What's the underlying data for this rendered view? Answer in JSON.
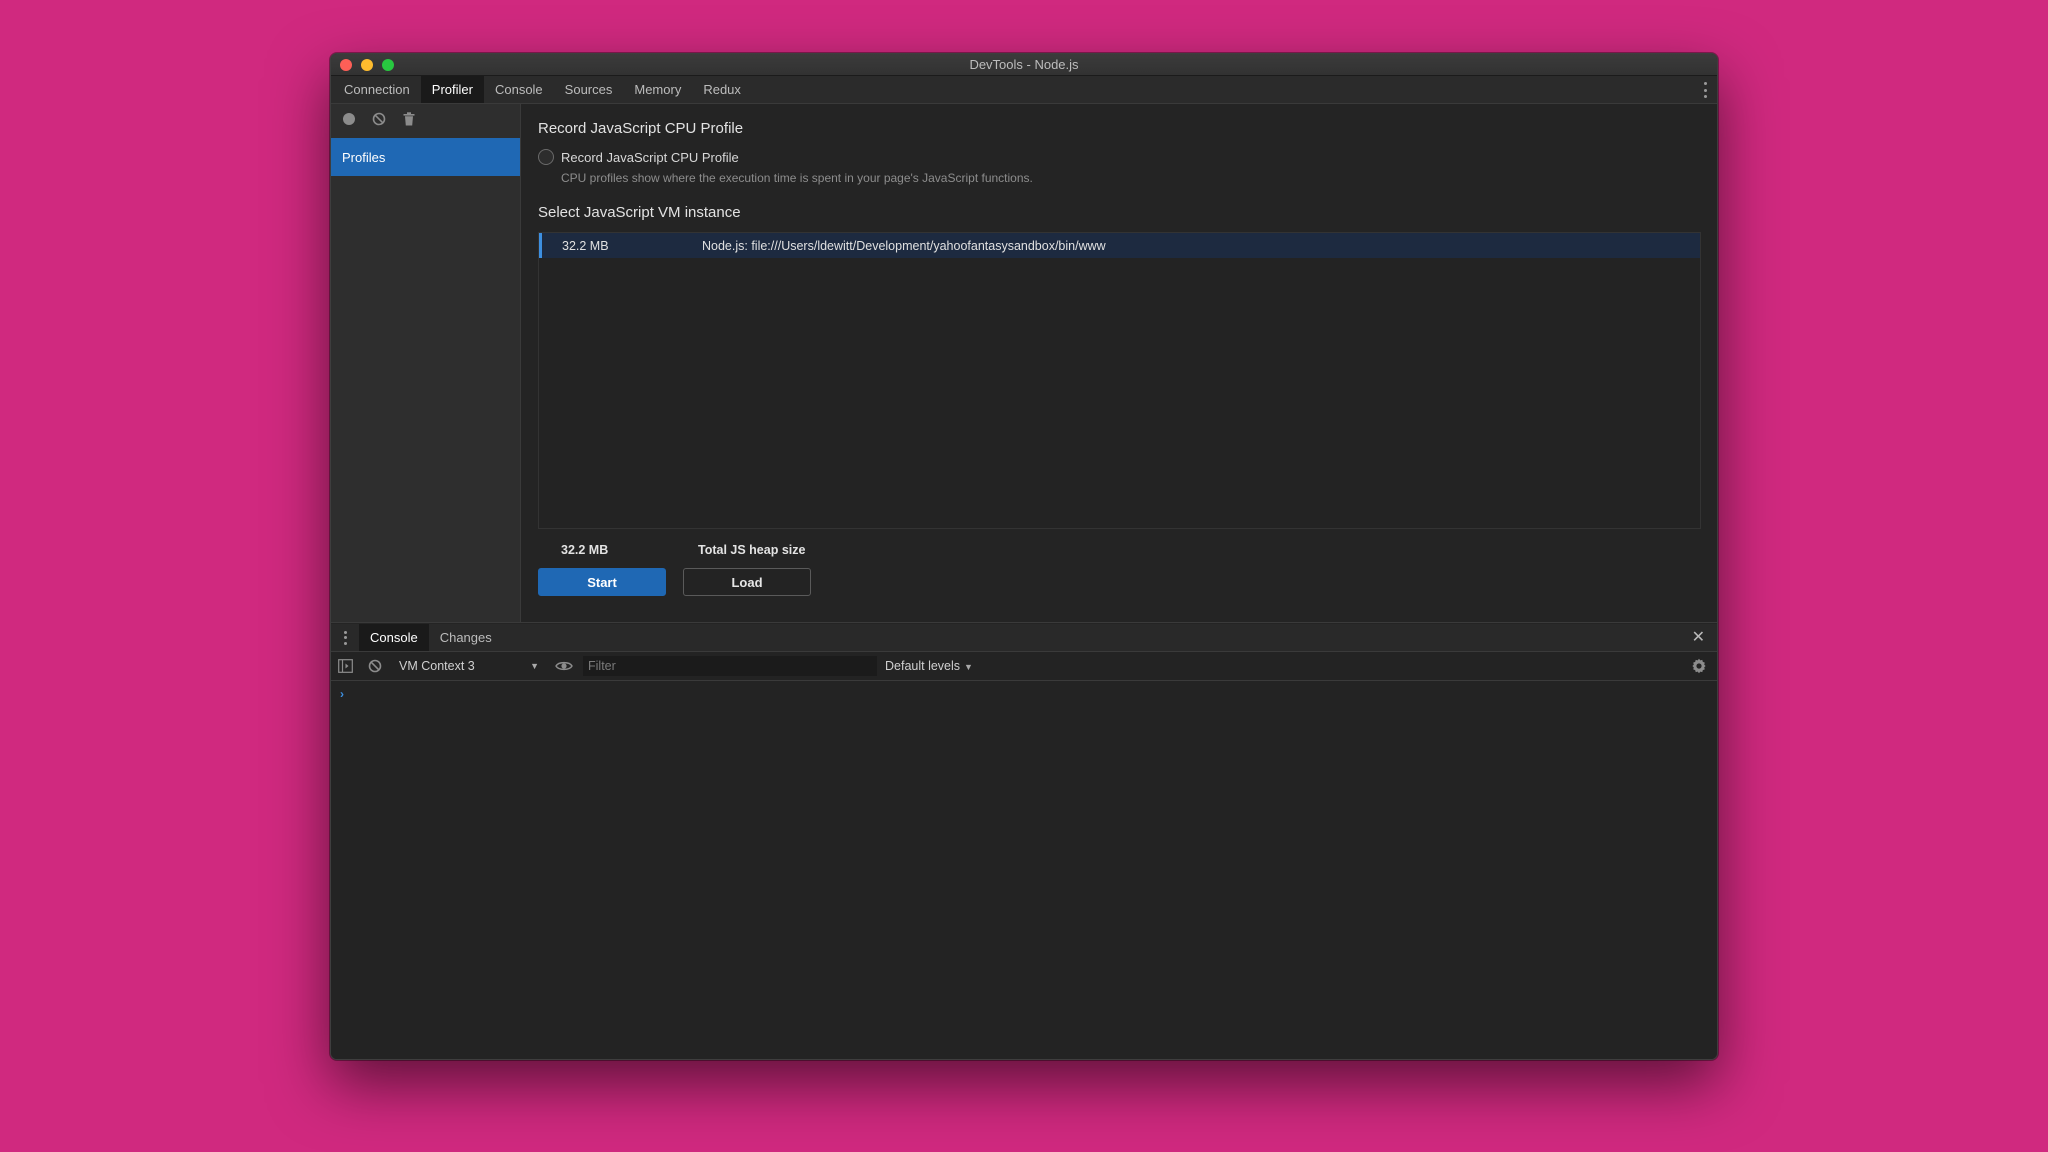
{
  "window": {
    "title": "DevTools - Node.js"
  },
  "tabs": [
    "Connection",
    "Profiler",
    "Console",
    "Sources",
    "Memory",
    "Redux"
  ],
  "active_tab": "Profiler",
  "sidebar": {
    "items": [
      "Profiles"
    ]
  },
  "profiler": {
    "heading": "Record JavaScript CPU Profile",
    "option_label": "Record JavaScript CPU Profile",
    "option_description": "CPU profiles show where the execution time is spent in your page's JavaScript functions.",
    "vm_heading": "Select JavaScript VM instance",
    "vm_instances": [
      {
        "size": "32.2 MB",
        "name": "Node.js: file:///Users/ldewitt/Development/yahoofantasysandbox/bin/www"
      }
    ],
    "total_size": "32.2 MB",
    "total_label": "Total JS heap size",
    "start_label": "Start",
    "load_label": "Load"
  },
  "drawer": {
    "tabs": [
      "Console",
      "Changes"
    ],
    "active_tab": "Console",
    "context": "VM Context 3",
    "filter_placeholder": "Filter",
    "levels": "Default levels",
    "prompt": "›"
  },
  "colors": {
    "background": "#d0297f",
    "accent": "#1f68b4"
  }
}
